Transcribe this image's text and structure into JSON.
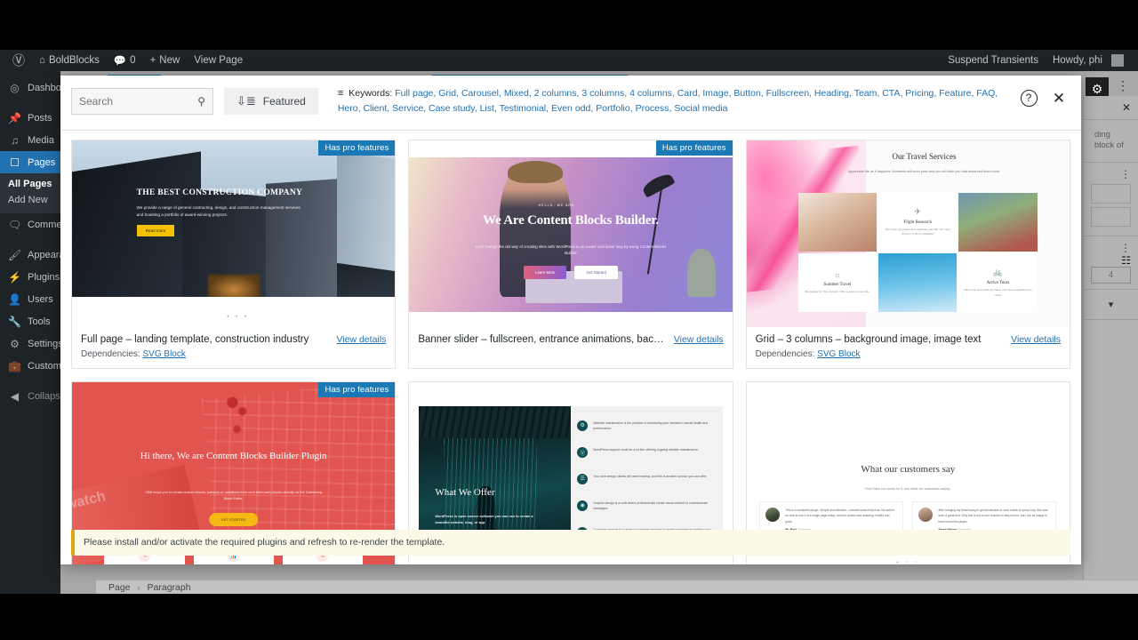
{
  "adminbar": {
    "logo_icon": "wordpress-logo-icon",
    "site_icon": "home-icon",
    "site_name": "BoldBlocks",
    "comments_icon": "comment-bubble-icon",
    "comments_count": "0",
    "new_icon": "plus-icon",
    "new_label": "New",
    "view_page_label": "View Page",
    "suspend_label": "Suspend Transients",
    "howdy_label": "Howdy, phi"
  },
  "sidebar": {
    "items": [
      {
        "label": "Dashboard",
        "icon": "dashboard-icon"
      },
      {
        "label": "Posts",
        "icon": "pin-icon"
      },
      {
        "label": "Media",
        "icon": "media-icon"
      },
      {
        "label": "Pages",
        "icon": "page-icon"
      },
      {
        "label": "Comments",
        "icon": "comment-icon"
      },
      {
        "label": "Appearance",
        "icon": "brush-icon"
      },
      {
        "label": "Plugins",
        "icon": "plug-icon"
      },
      {
        "label": "Users",
        "icon": "user-icon"
      },
      {
        "label": "Tools",
        "icon": "wrench-icon"
      },
      {
        "label": "Settings",
        "icon": "settings-icon"
      },
      {
        "label": "Custom B",
        "icon": "briefcase-icon"
      },
      {
        "label": "Collapse m",
        "icon": "collapse-icon"
      }
    ],
    "submenu": [
      {
        "label": "All Pages",
        "current": true
      },
      {
        "label": "Add New",
        "current": false
      }
    ]
  },
  "editor": {
    "gear_icon": "settings-gear-icon",
    "kebab_icon": "more-options-icon",
    "close_icon": "close-icon",
    "panel_text": "ding block of",
    "panel_kebab_icon": "more-options-icon",
    "slider_icon": "slider-settings-icon",
    "number_value": "4",
    "chevron_icon": "chevron-down-icon"
  },
  "breadcrumb": {
    "items": [
      "Page",
      "Paragraph"
    ],
    "separator": "›"
  },
  "modal": {
    "search": {
      "value": "",
      "placeholder": "Search",
      "icon": "search-icon"
    },
    "sort": {
      "label": "Featured",
      "icon": "sort-icon"
    },
    "keywords": {
      "icon": "filter-icon",
      "label": "Keywords:",
      "items": [
        "Full page",
        "Grid",
        "Carousel",
        "Mixed",
        "2 columns",
        "3 columns",
        "4 columns",
        "Card",
        "Image",
        "Button",
        "Fullscreen",
        "Heading",
        "Team",
        "CTA",
        "Pricing",
        "Feature",
        "FAQ",
        "Hero",
        "Client",
        "Service",
        "Case study",
        "List",
        "Testimonial",
        "Even odd",
        "Portfolio",
        "Process",
        "Social media"
      ]
    },
    "help_icon": "help-circle-icon",
    "close_icon": "close-icon",
    "pro_badge_label": "Has pro features",
    "view_details_label": "View details",
    "dependencies_label": "Dependencies:",
    "dependency_link": "SVG Block",
    "notice": "Please install and/or activate the required plugins and refresh to re-render the template.",
    "cards": [
      {
        "title": "Full page – landing template, construction industry",
        "has_pro": true,
        "has_dependencies": true,
        "preview": {
          "heading": "THE BEST CONSTRUCTION COMPANY",
          "body": "We provide a range of general contracting, design, and construction management services and boasting a portfolio of award-winning projects.",
          "button": "Read more",
          "dots": "• • •"
        }
      },
      {
        "title": "Banner slider – fullscreen, entrance animations, backgroun...",
        "has_pro": true,
        "has_dependencies": false,
        "preview": {
          "eyebrow": "HELLO, WE ARE",
          "heading": "We Are Content Blocks Builder.",
          "body": "Let's change the old way of creating sites with WordPress to an easier and faster way by using Content Blocks Builder",
          "button_primary": "Learn More",
          "button_secondary": "Get Started"
        }
      },
      {
        "title": "Grid – 3 columns – background image, image text",
        "has_pro": false,
        "has_dependencies": true,
        "preview": {
          "heading": "Our Travel Services",
          "body": "Appreciate life as it happens. Moments will soon pass and you will wish you had treasured them more.",
          "cells": [
            {
              "title": "Flight Research",
              "text": "The more you praise and celebrate your life, the more there is in life to celebrate",
              "icon": "airplane-icon"
            },
            {
              "title": "Summer Travel",
              "text": "Be happier for this moment. This moment is your life.",
              "icon": "sun-icon"
            },
            {
              "title": "Active Tours",
              "text": "When you love what you have, you have everything you need.",
              "icon": "bicycle-icon"
            }
          ]
        }
      },
      {
        "title": "",
        "has_pro": true,
        "has_dependencies": false,
        "preview": {
          "heading": "Hi there, We are Content Blocks Builder Plugin",
          "body": "CBB helps you to create custom blocks, patterns or variations from core third party blocks directly on the Gutenberg Block Editor.",
          "button": "GET STARTED",
          "swatch_text": "swatch",
          "icons": [
            "pen-icon",
            "chart-icon",
            "rocket-icon"
          ]
        }
      },
      {
        "title": "",
        "has_pro": false,
        "has_dependencies": false,
        "preview": {
          "heading": "What We Offer",
          "body": "WordPress is open source software you can use to create a beautiful website, blog, or app.",
          "rows": [
            {
              "icon": "gear-icon",
              "text": "Website maintenance is the practice of monitoring your website's overall health and performance."
            },
            {
              "icon": "wordpress-icon",
              "text": "WordPress support could be a lot like offering ongoing website maintenance."
            },
            {
              "icon": "server-icon",
              "text": "Your web design clients will need hosting, and this is another service you can offer."
            },
            {
              "icon": "palette-icon",
              "text": "Graphic design is a craft where professionals create visual content to communicate messages."
            },
            {
              "icon": "people-icon",
              "text": "Customer support is a range of customer services to assist customers in making cost-effective and correct use of a product."
            }
          ]
        }
      },
      {
        "title": "",
        "has_pro": false,
        "has_dependencies": false,
        "preview": {
          "heading": "What our customers say",
          "body": "Don't take our words for it, see what our customers saying.",
          "testimonials": [
            {
              "quote": "This is a wonderful plugin. Simple and effective. I needed some help from the author on how to use it in a single page setup, and the author was amazing, helpful and quick.",
              "name": "Mr. Raul",
              "role": "Developer"
            },
            {
              "quote": "After banging my head trying to get shortcodes to work inside of query loop, this was such a great find. Why this is not a core function is beyond me, but I am so happy to have found this plugin.",
              "name": "Sarah Warren",
              "role": "Developer"
            }
          ],
          "dots": "● ○ ○"
        }
      }
    ]
  },
  "colors": {
    "wp_blue": "#2271b1",
    "admin_dark": "#1d2327",
    "badge_blue": "#1b7ab5",
    "notice_border": "#dba617"
  }
}
